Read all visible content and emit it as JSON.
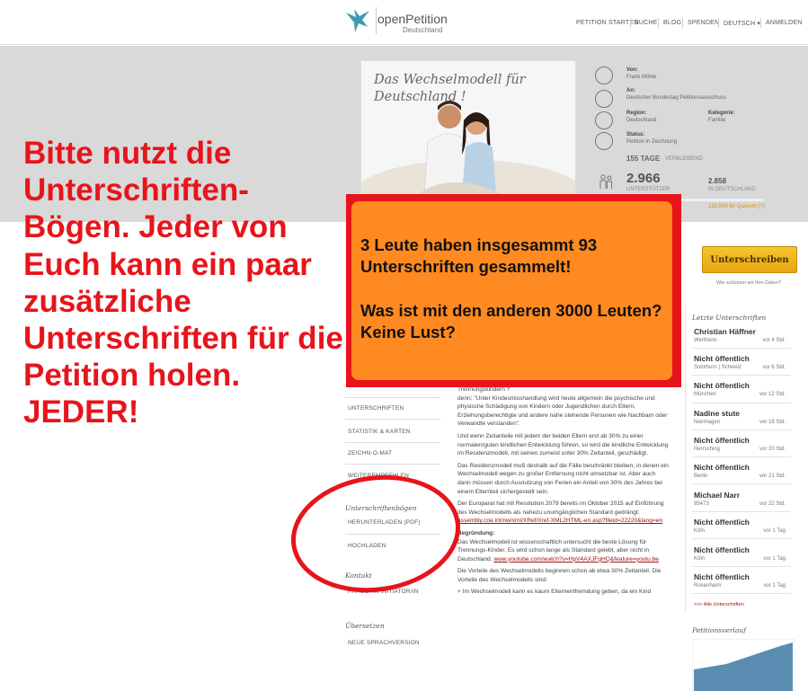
{
  "header": {
    "logo_name": "openPetition",
    "logo_sub": "Deutschland",
    "nav": [
      "PETITION STARTEN",
      "SUCHE",
      "BLOG",
      "SPENDEN",
      "DEUTSCH ▾",
      "ANMELDEN"
    ]
  },
  "petition": {
    "image_title": "Das Wechselmodell für Deutschland !",
    "von_label": "Von:",
    "von_value": "Frank Möhle",
    "an_label": "An:",
    "an_value": "Deutscher Bundestag Petitionsausschuss",
    "region_label": "Region:",
    "region_value": "Deutschland",
    "kategorie_label": "Kategorie:",
    "kategorie_value": "Familie",
    "status_label": "Status:",
    "status_value": "Petition in Zeichnung",
    "days_number": "155 TAGE",
    "days_label": "VERBLEIBEND",
    "supporters": "2.966",
    "supporters_label": "UNTERSTÜTZER",
    "in_germany": "2.858",
    "in_germany_label": "IN DEUTSCHLAND",
    "progress_fraction": 0.024,
    "quorum": "120.000   für Quorum   (?)"
  },
  "sidebar": {
    "unterschriften": "UNTERSCHRIFTEN",
    "statistik": "STATISTIK & KARTEN",
    "zeichnomat": "ZEICHN-O-MAT",
    "weiterempfehlen": "WEITEREMPFEHLEN",
    "boegen_head": "Unterschriftenbögen",
    "herunterladen": "HERUNTERLADEN (PDF)",
    "hochladen": "HOCHLADEN",
    "kontakt_head": "Kontakt",
    "frage": "FRAGE AN INITIATOR/IN",
    "uebersetzen_head": "Übersetzen",
    "sprachversion": "NEUE SPRACHVERSION"
  },
  "article": {
    "p1a": "Trennungskindern ?",
    "p1": "denn: \"Unter Kindesmisshandlung wird heute allgemein die psychische und physische Schädigung von Kindern oder Jugendlichen durch Eltern, Erziehungsberechtigte und andere nahe stehende Personen wie Nachbarn oder Verwandte verstanden\".",
    "p2": "Und wenn Zeitanteile mit jedem der beiden Eltern erst ab 30% zu einer normalen/guten kindlichen Entwicklung führen, so wird die kindliche Entwicklung im Residenzmodell, mit seinen zumeist unter 30% Zeitanteil, geschädigt.",
    "p3": "Das Residenzmodell muß deshalb auf die Fälle beschränkt bleiben, in denen ein Wechselmodell wegen zu großer Entfernung nicht umsetzbar ist. Aber auch dann müssen durch Ausnutzung von Ferien ein Anteil von 30% des Jahres bei einem Elternteil sichergestellt sein.",
    "p4": "Der Europarat hat mit Resolution 2079 bereits im Oktober 2015 auf Einführung des Wechselmodells als nahezu unumgänglichen Standard gedrängt:",
    "p4_link": "assembly.coe.int/nw/xml/XRef/Xref-XML2HTML-en.asp?fileid=22220&lang=en",
    "p5_head": "Begründung:",
    "p5": "Das Wechselmodell ist wissenschaftlich untersucht die beste Lösung für Trennungs-Kinder. Es wird schon lange als Standard gelebt, aber nicht in Deutschland.",
    "p5_link": "www.youtube.com/watch?v=HpV4AXJFgHQ&feature=youtu.be",
    "p6": "Die Vorteile des Wechselmodells beginnen schon ab etwa 30% Zeitanteil. Die Vorteile des Wechselmodells sind:",
    "p7": "+ Im Wechselmodell kann es kaum Elternentfremdung geben, da ein Kind"
  },
  "right": {
    "sign_button": "Unterschreiben",
    "data_note": "Wie schützen wir Ihre Daten?",
    "signers_title": "Letzte Unterschriften",
    "signers": [
      {
        "name": "Christian Häffner",
        "place": "Wertheim",
        "time": "vor 4 Std."
      },
      {
        "name": "Nicht öffentlich",
        "place": "Solothurn | Schweiz",
        "time": "vor 6 Std."
      },
      {
        "name": "Nicht öffentlich",
        "place": "München",
        "time": "vor 12 Std."
      },
      {
        "name": "Nadine stute",
        "place": "Nienhagen",
        "time": "vor 18 Std."
      },
      {
        "name": "Nicht öffentlich",
        "place": "Herrsching",
        "time": "vor 20 Std."
      },
      {
        "name": "Nicht öffentlich",
        "place": "Berlin",
        "time": "vor 21 Std."
      },
      {
        "name": "Michael Narr",
        "place": "95473",
        "time": "vor 22 Std."
      },
      {
        "name": "Nicht öffentlich",
        "place": "Köln",
        "time": "vor 1 Tag"
      },
      {
        "name": "Nicht öffentlich",
        "place": "Köln",
        "time": "vor 1 Tag"
      },
      {
        "name": "Nicht öffentlich",
        "place": "Rosenheim",
        "time": "vor 1 Tag"
      }
    ],
    "all_signers": ">>> Alle Unterschriften",
    "verlauf_title": "Petitionsverlauf"
  },
  "overlay": {
    "big_text": "Bitte nutzt die Unterschriften-Bögen. Jeder von Euch kann ein paar zusätzliche Unterschriften für die Petition holen. JEDER!",
    "callout_line1": "3 Leute haben insgesammt 93 Unterschriften gesammelt!",
    "callout_line2": "Was ist mit den anderen 3000 Leuten? Keine Lust?"
  },
  "colors": {
    "overlay_red": "#e8141b",
    "callout_orange": "#ff8a21",
    "button_gold": "#f2b21c",
    "link_red": "#a01010"
  }
}
